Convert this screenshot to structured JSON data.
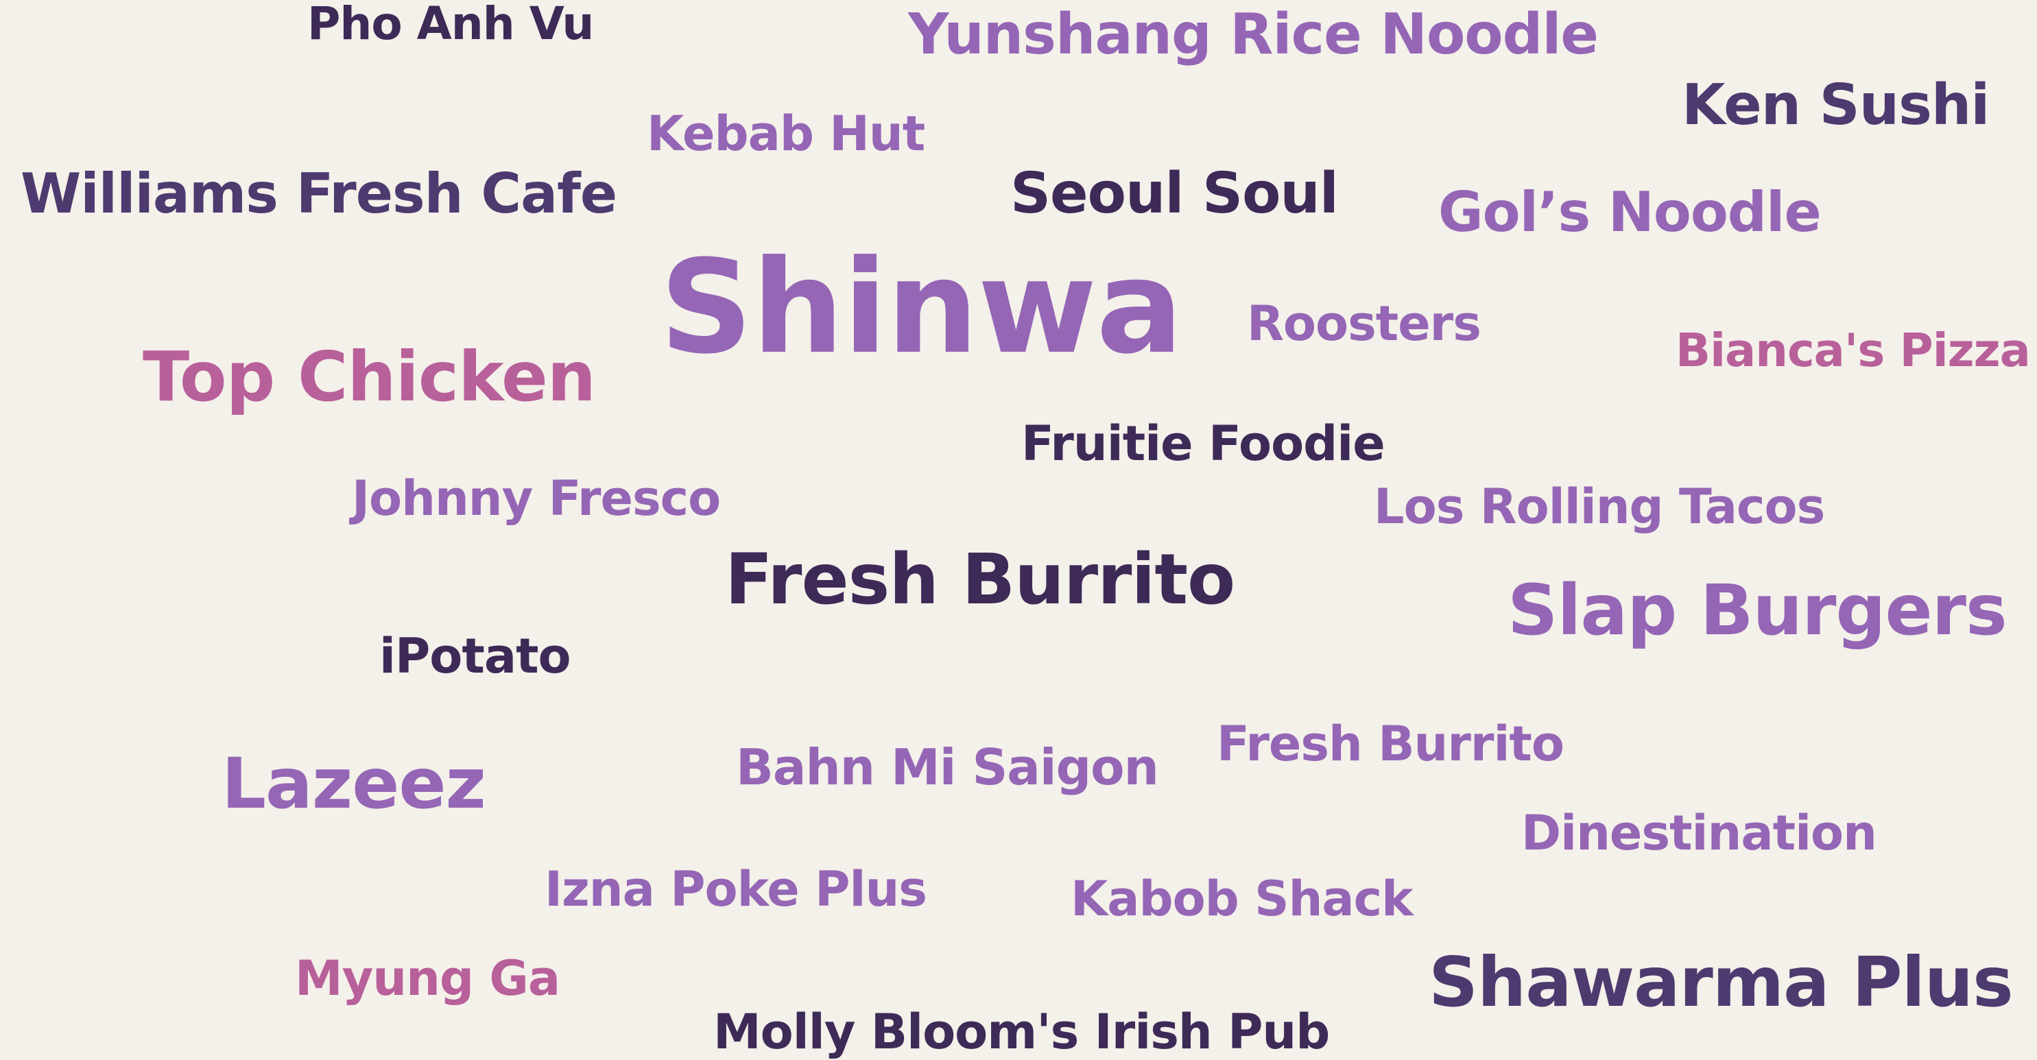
{
  "theme": {
    "background": "#f4f0ea",
    "dark": "#3d2a57",
    "deep": "#4d3a6e",
    "light": "#9466b5",
    "pink": "#b8609a"
  },
  "words": [
    {
      "text": "Pho Anh Vu",
      "color": "dark"
    },
    {
      "text": "Yunshang Rice Noodle",
      "color": "light"
    },
    {
      "text": "Ken Sushi",
      "color": "deep"
    },
    {
      "text": "Kebab Hut",
      "color": "light"
    },
    {
      "text": "Williams Fresh Cafe",
      "color": "deep"
    },
    {
      "text": "Seoul Soul",
      "color": "dark"
    },
    {
      "text": "Gol’s Noodle",
      "color": "light"
    },
    {
      "text": "Shinwa",
      "color": "light"
    },
    {
      "text": "Roosters",
      "color": "light"
    },
    {
      "text": "Bianca's Pizza",
      "color": "pink"
    },
    {
      "text": "Top Chicken",
      "color": "pink"
    },
    {
      "text": "Fruitie Foodie",
      "color": "dark"
    },
    {
      "text": "Johnny Fresco",
      "color": "light"
    },
    {
      "text": "Los Rolling Tacos",
      "color": "light"
    },
    {
      "text": "Fresh Burrito",
      "color": "dark"
    },
    {
      "text": "Slap Burgers",
      "color": "light"
    },
    {
      "text": "iPotato",
      "color": "dark"
    },
    {
      "text": "Fresh Burrito",
      "color": "light"
    },
    {
      "text": "Lazeez",
      "color": "light"
    },
    {
      "text": "Bahn Mi Saigon",
      "color": "light"
    },
    {
      "text": "Dinestination",
      "color": "light"
    },
    {
      "text": "Izna Poke Plus",
      "color": "light"
    },
    {
      "text": "Kabob Shack",
      "color": "light"
    },
    {
      "text": "Myung Ga",
      "color": "pink"
    },
    {
      "text": "Shawarma Plus",
      "color": "deep"
    },
    {
      "text": "Molly Bloom's Irish Pub",
      "color": "dark"
    }
  ]
}
